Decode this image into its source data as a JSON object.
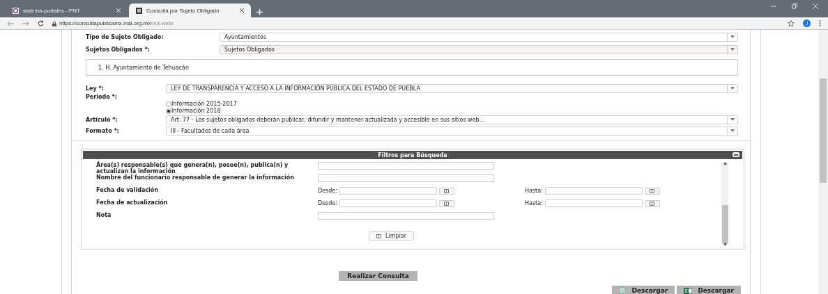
{
  "browser": {
    "tabs": [
      {
        "title": "sistema-portales - PNT",
        "selected": false
      },
      {
        "title": "Consulta por Sujeto Obligado",
        "selected": true
      }
    ],
    "url_host": "https://consultapublicamx.inai.org.mx",
    "url_path": "/vut-web/",
    "avatar": "J"
  },
  "form": {
    "top_fields": [
      {
        "label": "Tipo de Sujeto Obligado:",
        "value": "Ayuntamientos",
        "disabled": false
      },
      {
        "label": "Sujetos Obligados *:",
        "value": "Sujetos Obligados",
        "disabled": true
      }
    ],
    "selected_subjects": [
      "1. H. Ayuntamiento de Tehuacán"
    ],
    "fields": [
      {
        "kind": "select",
        "label": "Ley *:",
        "value": "LEY DE TRANSPARENCIA Y ACCESO A LA INFORMACIÓN PÚBLICA DEL ESTADO DE PUEBLA"
      },
      {
        "kind": "radio",
        "label": "Periodo *:",
        "options": [
          {
            "label": "Información 2015-2017",
            "selected": false
          },
          {
            "label": "Información 2018",
            "selected": true
          }
        ]
      },
      {
        "kind": "select",
        "label": "Artículo *:",
        "value": "Art. 77 - Los sujetos obligados deberán publicar, difundir y mantener actualizada y accesible en sus sitios web..."
      },
      {
        "kind": "select",
        "label": "Formato *:",
        "value": "III - Facultades de cada área"
      }
    ]
  },
  "filters": {
    "title": "Filtros para Búsqueda",
    "rows": [
      {
        "kind": "text",
        "label": "Área(s) responsable(s) que genera(n), posee(n), publica(n) y actualizan la información"
      },
      {
        "kind": "text",
        "label": "Nombre del funcionario responsable de generar la información"
      },
      {
        "kind": "range",
        "label": "Fecha de validación",
        "from": "Desde:",
        "to": "Hasta:"
      },
      {
        "kind": "range",
        "label": "Fecha de actualización",
        "from": "Desde:",
        "to": "Hasta:"
      },
      {
        "kind": "text",
        "label": "Nota"
      }
    ],
    "clear_button": "Limpiar"
  },
  "submit_button": "Realizar Consulta",
  "download_buttons": [
    {
      "kind": "csv",
      "label": "Descargar"
    },
    {
      "kind": "excel",
      "label": "Descargar"
    }
  ]
}
